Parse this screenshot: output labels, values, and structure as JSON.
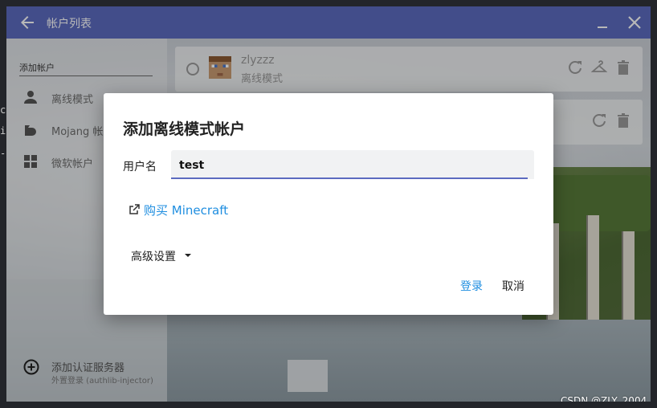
{
  "window": {
    "title": "帐户列表",
    "accent": "#5c6bc0"
  },
  "sidebar": {
    "section_title": "添加帐户",
    "items": [
      {
        "label": "离线模式",
        "icon": "person-icon"
      },
      {
        "label": "Mojang 帐户",
        "icon": "mojang-icon"
      },
      {
        "label": "微软帐户",
        "icon": "windows-icon"
      }
    ],
    "add_server": {
      "label": "添加认证服务器",
      "sub": "外置登录 (authlib-injector)"
    }
  },
  "accounts": [
    {
      "name": "zlyzzz",
      "type": "离线模式"
    }
  ],
  "dialog": {
    "title": "添加离线模式帐户",
    "username_label": "用户名",
    "username_value": "test",
    "buy_link": "购买 Minecraft",
    "advanced": "高级设置",
    "login_button": "登录",
    "cancel_button": "取消",
    "link_color": "#1f8ee0"
  },
  "watermark": "CSDN @ZLY_2004"
}
